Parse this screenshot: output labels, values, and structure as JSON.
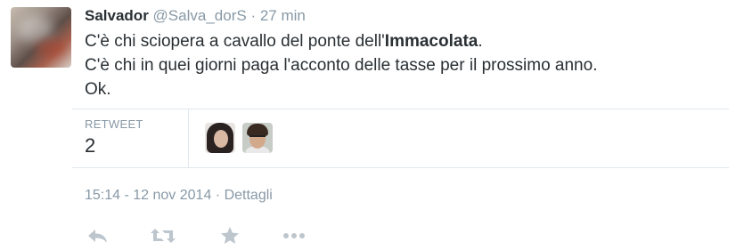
{
  "tweet": {
    "author_name": "Salvador",
    "author_handle": "@Salva_dorS",
    "separator": "·",
    "relative_time": "27 min",
    "text_line1_prefix": "C'è chi sciopera a cavallo del ponte dell'",
    "text_line1_bold": "Immacolata",
    "text_line1_suffix": ".",
    "text_line2": "C'è chi in quei giorni paga l'acconto delle tasse per il prossimo anno.",
    "text_line3": "Ok."
  },
  "stats": {
    "retweet_label": "RETWEET",
    "retweet_count": "2"
  },
  "meta": {
    "timestamp": "15:14 - 12 nov 2014",
    "separator": "·",
    "details_link": "Dettagli"
  },
  "actions": {
    "icons": [
      "reply-icon",
      "retweet-icon",
      "favorite-icon",
      "more-icon"
    ],
    "color": "#bdc6cd"
  }
}
